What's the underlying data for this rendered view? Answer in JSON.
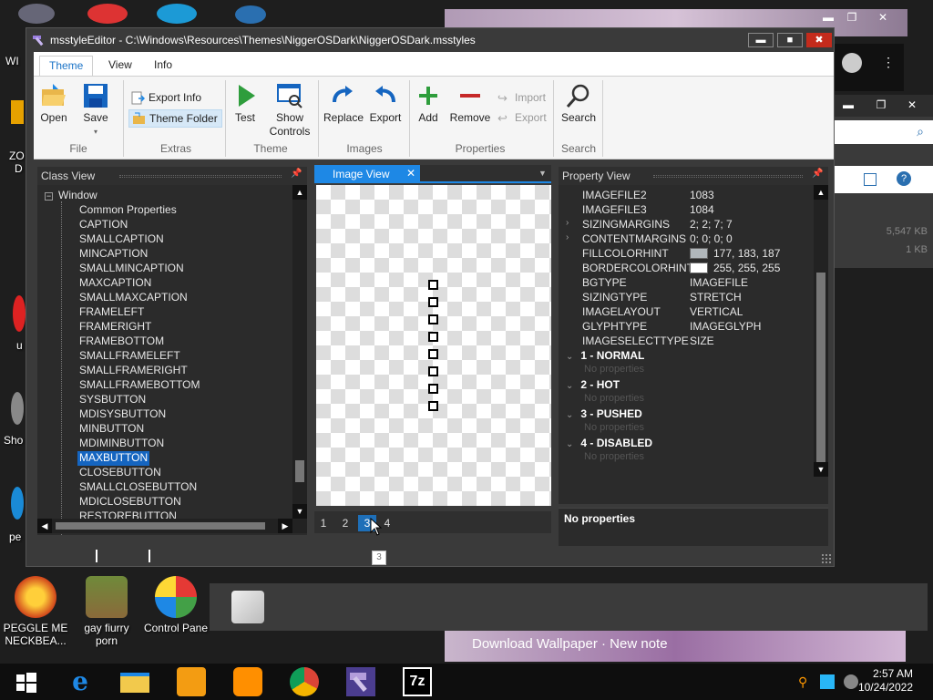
{
  "window": {
    "title": "msstyleEditor - C:\\Windows\\Resources\\Themes\\NiggerOSDark\\NiggerOSDark.msstyles",
    "minimize": "▬",
    "maximize": "■",
    "close": "✖"
  },
  "ribbon": {
    "tabs": [
      "Theme",
      "View",
      "Info"
    ],
    "buttons": {
      "open": "Open",
      "save": "Save",
      "export_info": "Export Info",
      "theme_folder": "Theme Folder",
      "test": "Test",
      "show_controls": "Show Controls",
      "replace": "Replace",
      "export": "Export",
      "add": "Add",
      "remove": "Remove",
      "import": "Import",
      "export_prop": "Export",
      "search": "Search"
    },
    "groups": [
      "File",
      "Extras",
      "Theme",
      "Images",
      "Properties",
      "Search"
    ]
  },
  "class_view": {
    "header": "Class View",
    "root": "Window",
    "items": [
      "Common Properties",
      "CAPTION",
      "SMALLCAPTION",
      "MINCAPTION",
      "SMALLMINCAPTION",
      "MAXCAPTION",
      "SMALLMAXCAPTION",
      "FRAMELEFT",
      "FRAMERIGHT",
      "FRAMEBOTTOM",
      "SMALLFRAMELEFT",
      "SMALLFRAMERIGHT",
      "SMALLFRAMEBOTTOM",
      "SYSBUTTON",
      "MDISYSBUTTON",
      "MINBUTTON",
      "MDIMINBUTTON",
      "MAXBUTTON",
      "CLOSEBUTTON",
      "SMALLCLOSEBUTTON",
      "MDICLOSEBUTTON",
      "RESTOREBUTTON"
    ],
    "selected": "MAXBUTTON"
  },
  "image_view": {
    "tab": "Image View",
    "close": "✕",
    "pages": [
      "1",
      "2",
      "3",
      "4"
    ],
    "active_page": "3",
    "tooltip": "3"
  },
  "property_view": {
    "header": "Property View",
    "props": [
      {
        "key": "IMAGEFILE2",
        "value": "1083"
      },
      {
        "key": "IMAGEFILE3",
        "value": "1084"
      },
      {
        "key": "SIZINGMARGINS",
        "value": "2; 2; 7; 7"
      },
      {
        "key": "CONTENTMARGINS",
        "value": "0; 0; 0; 0"
      },
      {
        "key": "FILLCOLORHINT",
        "value": "177, 183, 187"
      },
      {
        "key": "BORDERCOLORHINT",
        "value": "255, 255, 255"
      },
      {
        "key": "BGTYPE",
        "value": "IMAGEFILE"
      },
      {
        "key": "SIZINGTYPE",
        "value": "STRETCH"
      },
      {
        "key": "IMAGELAYOUT",
        "value": "VERTICAL"
      },
      {
        "key": "GLYPHTYPE",
        "value": "IMAGEGLYPH"
      },
      {
        "key": "IMAGESELECTTYPE",
        "value": "SIZE"
      }
    ],
    "states": [
      "1 - NORMAL",
      "2 - HOT",
      "3 - PUSHED",
      "4 - DISABLED"
    ],
    "no_props": "No properties",
    "description": "No properties",
    "fill_color": "#b1b7bb",
    "border_color": "#ffffff"
  },
  "desktop": {
    "icons": [
      "PEGGLE ME NECKBEA...",
      "gay fiurry porn",
      "Control Pane"
    ],
    "side_labels": [
      "WI",
      "ZO",
      "D",
      "u",
      "Sho",
      "pe"
    ],
    "bg_sizes": [
      "5,547 KB",
      "1 KB"
    ],
    "wallpaper_text": "Download Wallpaper · New note"
  },
  "taskbar": {
    "time": "2:57 AM",
    "date": "10/24/2022"
  },
  "colors": {
    "accent": "#1e88e5",
    "selection": "#1565c0"
  }
}
